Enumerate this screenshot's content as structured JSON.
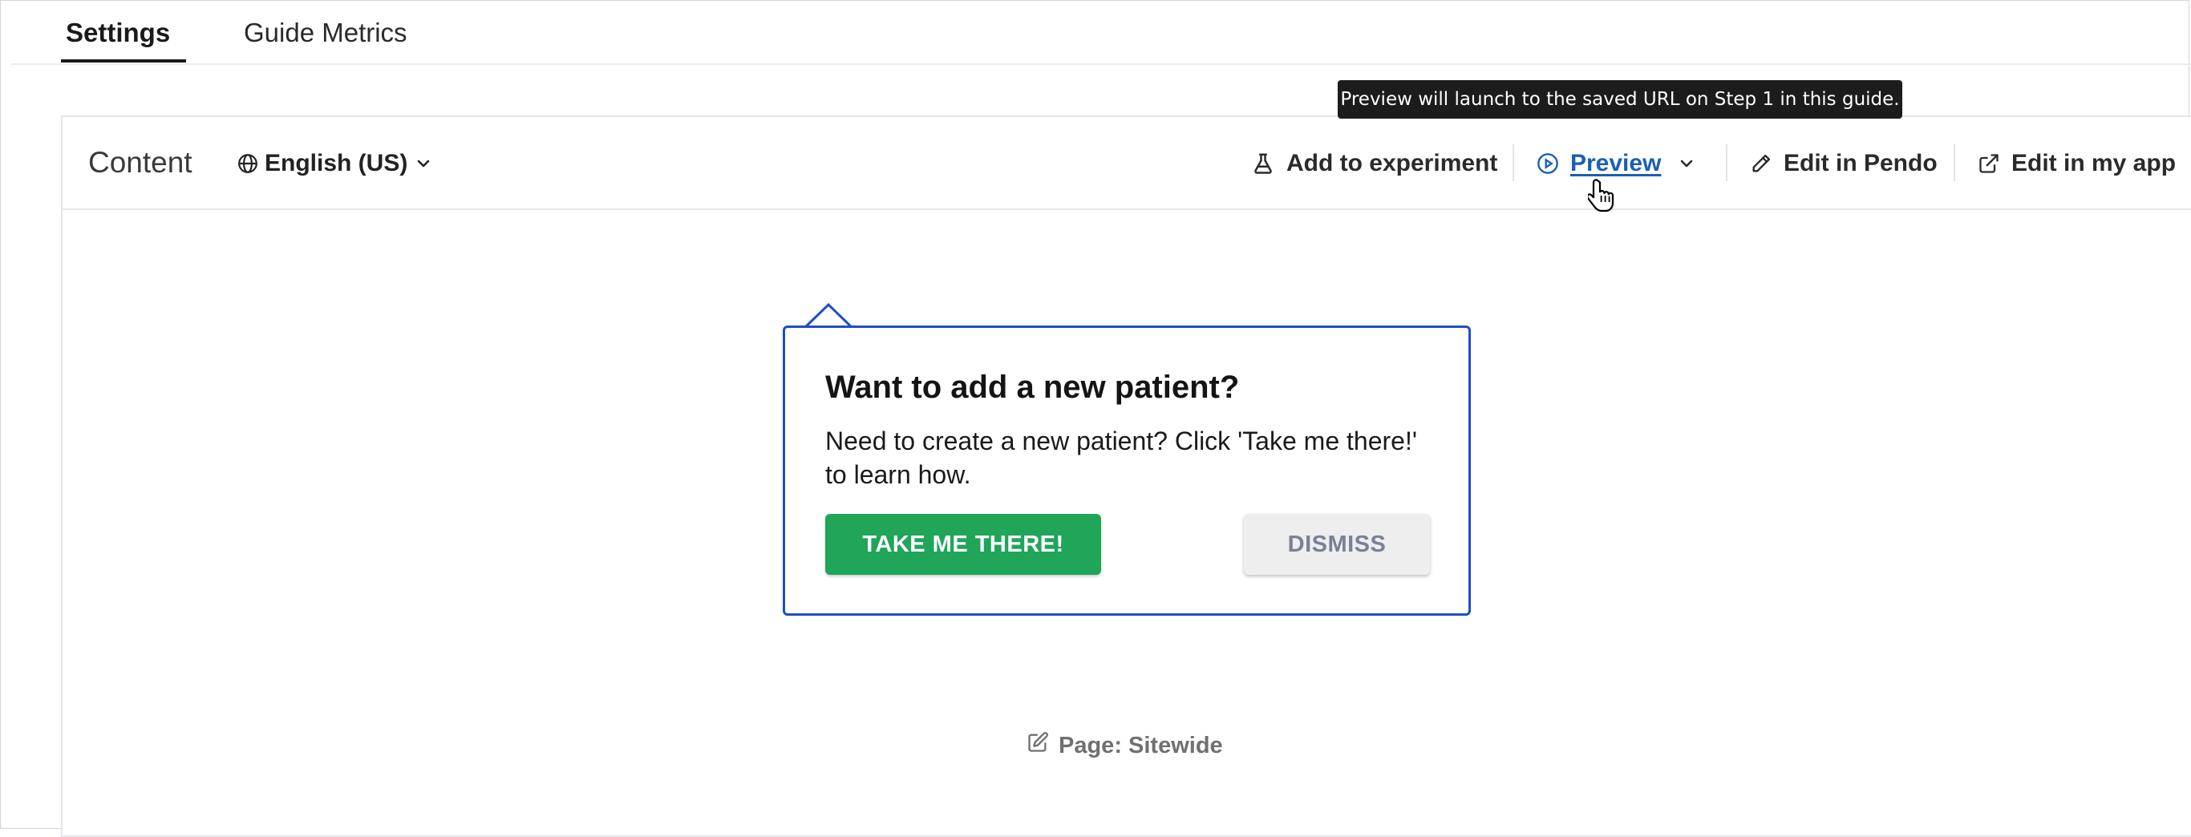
{
  "tabs": [
    {
      "label": "Settings",
      "active": true
    },
    {
      "label": "Guide Metrics",
      "active": false
    }
  ],
  "content": {
    "title": "Content",
    "language": "English (US)"
  },
  "actions": {
    "add_to_experiment": "Add to experiment",
    "preview": "Preview",
    "edit_in_pendo": "Edit in Pendo",
    "edit_in_my_app": "Edit in my app"
  },
  "tooltip": {
    "text": "Preview will launch to the saved URL on Step 1 in this guide."
  },
  "guide": {
    "title": "Want to add a new patient?",
    "body": "Need to create a new patient?  Click 'Take me there!'  to learn how.",
    "primary_button": "TAKE ME THERE!",
    "secondary_button": "DISMISS"
  },
  "page": {
    "label": "Page: Sitewide"
  },
  "colors": {
    "accent": "#1a5fb4",
    "guide_border": "#1d4fc4",
    "primary_button": "#20a559",
    "tooltip_bg": "#1c1c1c"
  }
}
